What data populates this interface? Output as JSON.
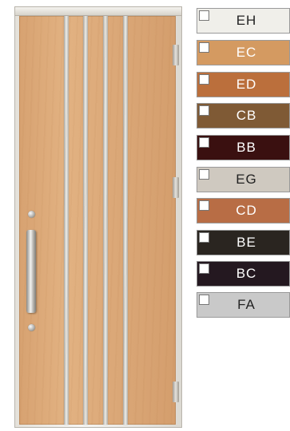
{
  "door": {
    "hinges": 3,
    "locks": 2
  },
  "swatches": [
    {
      "code": "EH",
      "color": "#f0efea",
      "text_color": "#222222"
    },
    {
      "code": "EC",
      "color": "#d49a61",
      "text_color": "#ffffff"
    },
    {
      "code": "ED",
      "color": "#bb6f3c",
      "text_color": "#ffffff"
    },
    {
      "code": "CB",
      "color": "#7f5a35",
      "text_color": "#ffffff"
    },
    {
      "code": "BB",
      "color": "#3a1010",
      "text_color": "#ffffff"
    },
    {
      "code": "EG",
      "color": "#cfc9c0",
      "text_color": "#222222"
    },
    {
      "code": "CD",
      "color": "#b86d45",
      "text_color": "#ffffff"
    },
    {
      "code": "BE",
      "color": "#2a2520",
      "text_color": "#ffffff"
    },
    {
      "code": "BC",
      "color": "#241820",
      "text_color": "#ffffff"
    },
    {
      "code": "FA",
      "color": "#c9c9c9",
      "text_color": "#222222"
    }
  ]
}
